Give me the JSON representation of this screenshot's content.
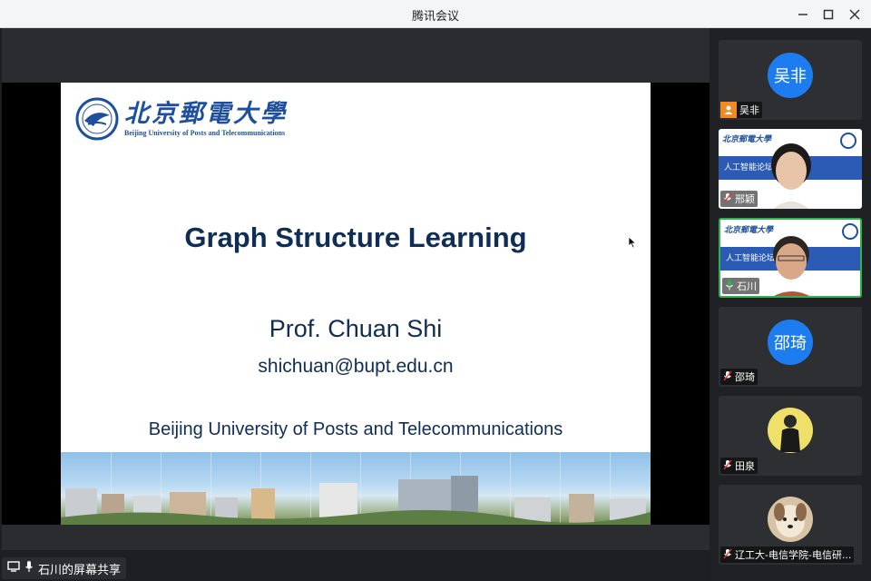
{
  "window": {
    "title": "腾讯会议",
    "minimize_icon": "minimize-icon",
    "maximize_icon": "maximize-icon",
    "close_icon": "close-icon"
  },
  "slide": {
    "logo_cn": "北京郵電大學",
    "logo_en": "Beijing University of Posts and Telecommunications",
    "title": "Graph Structure Learning",
    "author": "Prof. Chuan Shi",
    "email": "shichuan@bupt.edu.cn",
    "university": "Beijing University of Posts and Telecommunications"
  },
  "share_bar": {
    "label": "石川的屏幕共享",
    "screen_icon": "screen-share-icon",
    "mic_icon": "microphone-icon"
  },
  "participants": [
    {
      "name": "吴非",
      "avatar_text": "吴非",
      "kind": "avatar",
      "tag_icon": "person-icon"
    },
    {
      "name": "邢颖",
      "kind": "video",
      "mini_title": "北京郵電大學",
      "mini_band": "人工智能论坛",
      "tag_icon": "mic-muted-icon"
    },
    {
      "name": "石川",
      "kind": "video",
      "mini_title": "北京郵電大學",
      "mini_band": "人工智能论坛",
      "tag_icon": "mic-active-icon",
      "active": true
    },
    {
      "name": "邵琦",
      "avatar_text": "邵琦",
      "kind": "avatar",
      "tag_icon": "mic-muted-icon"
    },
    {
      "name": "田泉",
      "kind": "photo",
      "tag_icon": "mic-muted-icon"
    },
    {
      "name": "辽工大-电信学院-电信研...",
      "kind": "photo",
      "tag_icon": "mic-muted-icon"
    }
  ],
  "colors": {
    "accent": "#1d7df0",
    "active_border": "#2fb34f",
    "slide_text": "#0f2d55",
    "logo_blue": "#1e4f9c"
  }
}
